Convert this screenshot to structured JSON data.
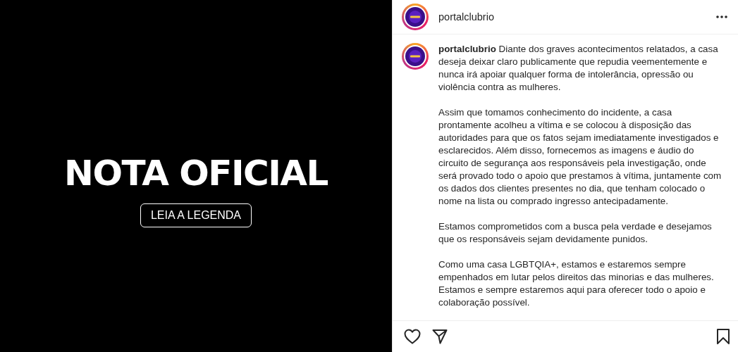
{
  "post_image": {
    "title": "NOTA OFICIAL",
    "button": "LEIA A LEGENDA"
  },
  "header": {
    "username": "portalclubrio"
  },
  "caption": {
    "paragraphs": [
      "**portalclubrio** Diante dos graves acontecimentos relatados, a casa deseja deixar claro publicamente que repudia veementemente e nunca irá apoiar qualquer forma de intolerância, opressão ou violência contra as mulheres.",
      "Assim que tomamos conhecimento do incidente, a casa prontamente acolheu a vítima e se colocou à disposição das autoridades para que os fatos sejam imediatamente investigados e esclarecidos. Além disso, fornecemos as imagens e áudio do circuito de segurança aos responsáveis pela investigação, onde será provado todo o apoio que prestamos à vítima, juntamente com os dados dos clientes presentes no dia, que tenham colocado o nome na lista ou comprado ingresso antecipadamente.",
      "Estamos comprometidos com a busca pela verdade e desejamos que os responsáveis sejam devidamente punidos.",
      "Como uma casa LGBTQIA+, estamos e estaremos sempre empenhados em lutar pelos direitos das minorias e das mulheres. Estamos e sempre estaremos aqui para oferecer todo o apoio e colaboração possível."
    ]
  },
  "actions": {
    "liked": false,
    "saved": false
  }
}
